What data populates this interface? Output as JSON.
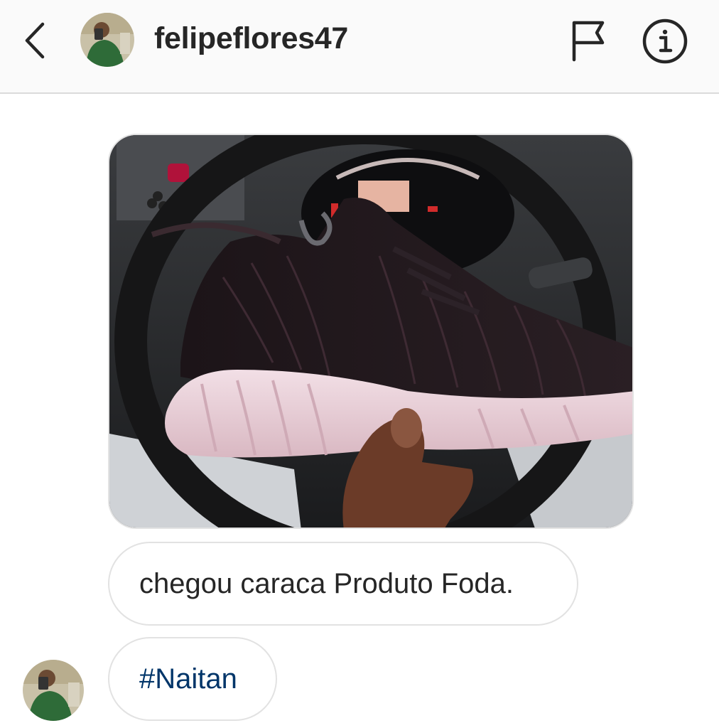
{
  "header": {
    "username": "felipeflores47",
    "back_icon": "chevron-left-icon",
    "flag_icon": "flag-icon",
    "info_icon": "info-icon"
  },
  "messages": [
    {
      "type": "photo",
      "subject": "black knit sneaker with white sole held in front of car steering wheel"
    },
    {
      "type": "text",
      "text": "chegou caraca Produto Foda."
    },
    {
      "type": "text",
      "text": "#Naitan"
    }
  ],
  "colors": {
    "header_bg": "#fafafa",
    "divider": "#dbdbdb",
    "text": "#262626",
    "hashtag": "#003569",
    "bubble_border": "#e2e2e2"
  }
}
